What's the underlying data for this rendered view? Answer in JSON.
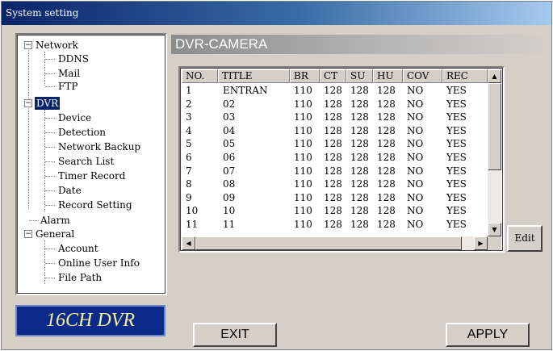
{
  "window": {
    "title": "System setting"
  },
  "tree": {
    "network": {
      "label": "Network",
      "expander": "−",
      "children": [
        "DDNS",
        "Mail",
        "FTP"
      ]
    },
    "dvr": {
      "label": "DVR",
      "expander": "−",
      "children": [
        "Device",
        "Detection",
        "Network Backup",
        "Search List",
        "Timer Record",
        "Date",
        "Record Setting"
      ]
    },
    "alarm": {
      "label": "Alarm"
    },
    "general": {
      "label": "General",
      "expander": "−",
      "children": [
        "Account",
        "Online User Info",
        "File Path"
      ]
    }
  },
  "logo": {
    "text": "16CH DVR"
  },
  "panel": {
    "title": "DVR-CAMERA"
  },
  "table": {
    "columns": [
      "NO.",
      "TITLE",
      "BR",
      "CT",
      "SU",
      "HU",
      "COV",
      "REC"
    ],
    "rows": [
      [
        "1",
        "ENTRAN",
        "110",
        "128",
        "128",
        "128",
        "NO",
        "YES"
      ],
      [
        "2",
        "02",
        "110",
        "128",
        "128",
        "128",
        "NO",
        "YES"
      ],
      [
        "3",
        "03",
        "110",
        "128",
        "128",
        "128",
        "NO",
        "YES"
      ],
      [
        "4",
        "04",
        "110",
        "128",
        "128",
        "128",
        "NO",
        "YES"
      ],
      [
        "5",
        "05",
        "110",
        "128",
        "128",
        "128",
        "NO",
        "YES"
      ],
      [
        "6",
        "06",
        "110",
        "128",
        "128",
        "128",
        "NO",
        "YES"
      ],
      [
        "7",
        "07",
        "110",
        "128",
        "128",
        "128",
        "NO",
        "YES"
      ],
      [
        "8",
        "08",
        "110",
        "128",
        "128",
        "128",
        "NO",
        "YES"
      ],
      [
        "9",
        "09",
        "110",
        "128",
        "128",
        "128",
        "NO",
        "YES"
      ],
      [
        "10",
        "10",
        "110",
        "128",
        "128",
        "128",
        "NO",
        "YES"
      ],
      [
        "11",
        "11",
        "110",
        "128",
        "128",
        "128",
        "NO",
        "YES"
      ]
    ]
  },
  "scroll": {
    "up_icon": "▲",
    "down_icon": "▼",
    "left_icon": "◀",
    "right_icon": "▶"
  },
  "buttons": {
    "edit": "Edit",
    "exit": "EXIT",
    "apply": "APPLY"
  },
  "colors": {
    "selection": "#0a246a",
    "logo_bg": "#0b2a8a",
    "logo_text": "#f5f0a0",
    "dialog_bg": "#d4d0c8"
  }
}
